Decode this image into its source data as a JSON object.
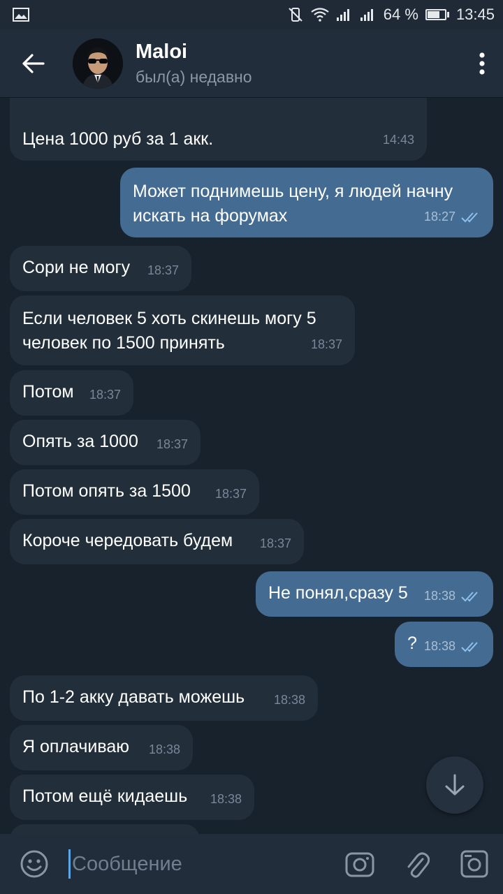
{
  "status_bar": {
    "battery_text": "64 %",
    "battery_level": 0.64,
    "time": "13:45",
    "icons": [
      "image-icon",
      "vibrate-off-icon",
      "wifi-icon",
      "signal-icon",
      "signal-icon",
      "battery-icon"
    ]
  },
  "header": {
    "name": "Maloi",
    "status": "был(а) недавно"
  },
  "messages": [
    {
      "dir": "in",
      "text": "Цена 1000 руб за 1 акк.",
      "time": "14:43"
    },
    {
      "dir": "out",
      "text": "Может поднимешь цену, я людей начну\nискать на форумах",
      "time": "18:27",
      "read": true
    },
    {
      "dir": "in",
      "text": "Сори не могу",
      "time": "18:37"
    },
    {
      "dir": "in",
      "text": "Если человек 5 хоть скинешь могу 5\nчеловек по 1500 принять",
      "time": "18:37"
    },
    {
      "dir": "in",
      "text": "Потом",
      "time": "18:37"
    },
    {
      "dir": "in",
      "text": "Опять за 1000",
      "time": "18:37"
    },
    {
      "dir": "in",
      "text": "Потом опять за 1500",
      "time": "18:37"
    },
    {
      "dir": "in",
      "text": "Короче чередовать будем",
      "time": "18:37"
    },
    {
      "dir": "out",
      "text": "Не понял,сразу 5",
      "time": "18:38",
      "read": true
    },
    {
      "dir": "out",
      "text": "?",
      "time": "18:38",
      "read": true
    },
    {
      "dir": "in",
      "text": "По 1-2 акку давать можешь",
      "time": "18:38"
    },
    {
      "dir": "in",
      "text": "Я оплачиваю",
      "time": "18:38"
    },
    {
      "dir": "in",
      "text": "Потом ещё кидаешь",
      "time": "18:38"
    },
    {
      "dir": "in",
      "text": "",
      "time": ""
    }
  ],
  "composer": {
    "placeholder": "Сообщение"
  },
  "colors": {
    "background": "#18222d",
    "header": "#212d3b",
    "incoming_bubble": "#222e3a",
    "outgoing_bubble": "#446b91",
    "accent": "#5ea6e6"
  }
}
